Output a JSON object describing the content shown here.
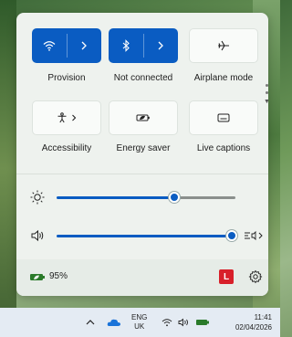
{
  "colors": {
    "accent": "#0a5cc2",
    "battery": "#2a7a2a",
    "user_badge": "#d8202a"
  },
  "tiles": [
    {
      "id": "wifi",
      "label": "Provision",
      "state": "on",
      "icon": "wifi-icon",
      "split": true
    },
    {
      "id": "bluetooth",
      "label": "Not connected",
      "state": "on",
      "icon": "bluetooth-icon",
      "split": true
    },
    {
      "id": "airplane",
      "label": "Airplane mode",
      "state": "off",
      "icon": "airplane-icon",
      "split": false
    },
    {
      "id": "accessibility",
      "label": "Accessibility",
      "state": "off",
      "icon": "accessibility-icon",
      "split": false
    },
    {
      "id": "energy",
      "label": "Energy saver",
      "state": "off",
      "icon": "energy-saver-icon",
      "split": false
    },
    {
      "id": "captions",
      "label": "Live captions",
      "state": "off",
      "icon": "live-captions-icon",
      "split": false
    }
  ],
  "sliders": {
    "brightness": {
      "icon": "brightness-icon",
      "level": 0.66
    },
    "volume": {
      "icon": "speaker-icon",
      "level": 0.98
    }
  },
  "footer": {
    "battery_percent": "95%",
    "user_initial": "L"
  },
  "taskbar": {
    "lang_line1": "ENG",
    "lang_line2": "UK",
    "time": "11:41",
    "date": "02/04/2026"
  }
}
